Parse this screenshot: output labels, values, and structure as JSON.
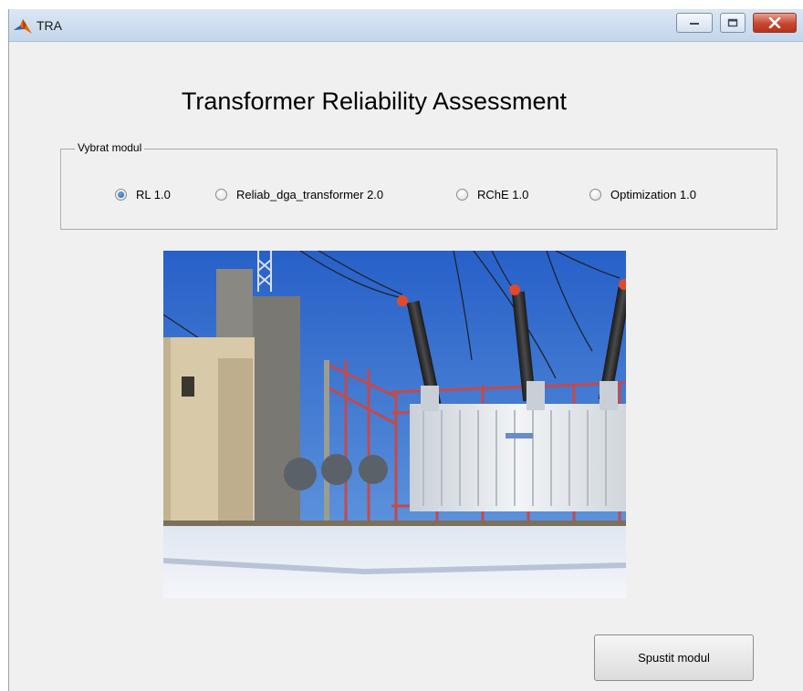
{
  "window": {
    "title": "TRA"
  },
  "main": {
    "heading": "Transformer Reliability Assessment",
    "module_group": {
      "label": "Vybrat modul",
      "options": [
        {
          "label": "RL 1.0",
          "checked": true
        },
        {
          "label": "Reliab_dga_transformer 2.0",
          "checked": false
        },
        {
          "label": "RChE 1.0",
          "checked": false
        },
        {
          "label": "Optimization 1.0",
          "checked": false
        }
      ]
    },
    "run_button_label": "Spustit modul"
  },
  "colors": {
    "sky": "#2f6fd1",
    "tank": "#e8ecef",
    "frame": "#c85050",
    "insulator_cap": "#e04a2a"
  }
}
